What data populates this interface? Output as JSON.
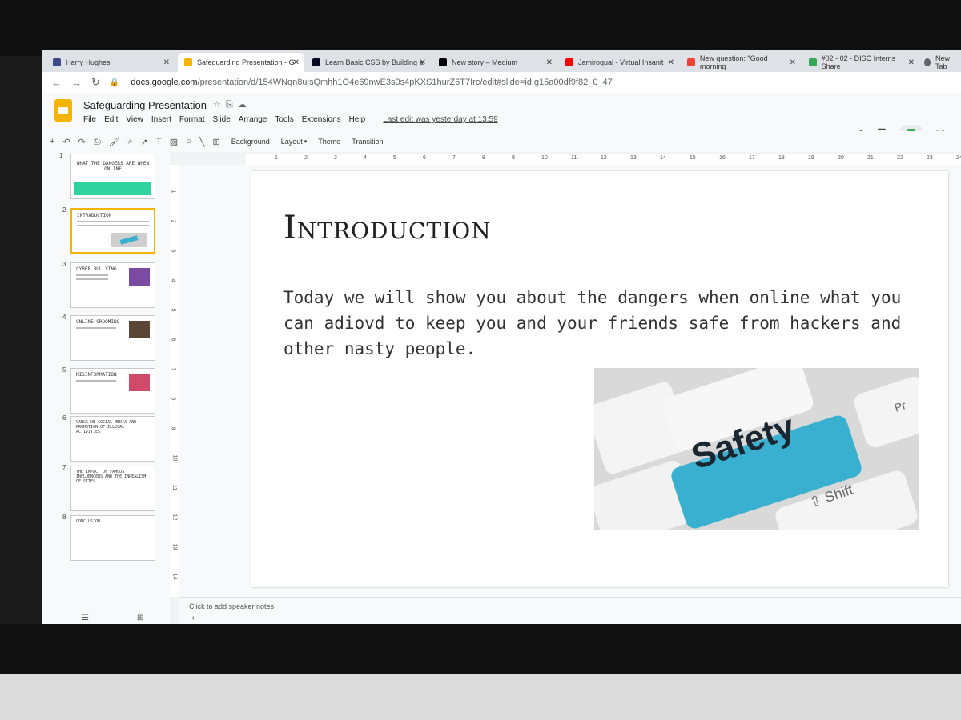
{
  "browser": {
    "tabs": [
      {
        "title": "Harry Hughes",
        "color": "#3c4a8a"
      },
      {
        "title": "Safeguarding Presentation - G",
        "color": "#f4b400",
        "active": true
      },
      {
        "title": "Learn Basic CSS by Building a",
        "color": "#0a0a23"
      },
      {
        "title": "New story – Medium",
        "color": "#000000"
      },
      {
        "title": "Jamiroquai - Virtual Insanit",
        "color": "#ff0000"
      },
      {
        "title": "New question: \"Good morning",
        "color": "#ea4335"
      },
      {
        "title": "#02 - 02 - DISC Interns Share",
        "color": "#34a853"
      },
      {
        "title": "New Tab",
        "color": "#5f6368"
      }
    ],
    "url_host": "docs.google.com",
    "url_path": "/presentation/d/154WNqn8ujsQmhh1O4e69nwE3s0s4pKXS1hurZ6T7Irc/edit#slide=id.g15a00df9f82_0_47"
  },
  "app": {
    "title": "Safeguarding Presentation",
    "menu": [
      "File",
      "Edit",
      "View",
      "Insert",
      "Format",
      "Slide",
      "Arrange",
      "Tools",
      "Extensions",
      "Help"
    ],
    "last_edit": "Last edit was yesterday at 13:59",
    "toolbar": {
      "background": "Background",
      "layout": "Layout",
      "theme": "Theme",
      "transition": "Transition"
    }
  },
  "ruler_h": [
    "1",
    "2",
    "3",
    "4",
    "5",
    "6",
    "7",
    "8",
    "9",
    "10",
    "11",
    "12",
    "13",
    "14",
    "15",
    "16",
    "17",
    "18",
    "19",
    "20",
    "21",
    "22",
    "23",
    "24"
  ],
  "ruler_v": [
    "1",
    "2",
    "3",
    "4",
    "5",
    "6",
    "7",
    "8",
    "9",
    "10",
    "11",
    "12",
    "13",
    "14"
  ],
  "filmstrip": [
    {
      "num": "1",
      "title": "What the dangers are when online"
    },
    {
      "num": "2",
      "title": "Introduction",
      "selected": true
    },
    {
      "num": "3",
      "title": "Cyber bullying"
    },
    {
      "num": "4",
      "title": "Online grooming"
    },
    {
      "num": "5",
      "title": "Misinformation"
    },
    {
      "num": "6",
      "title": "Gangs on social media and promotion of illegal activities"
    },
    {
      "num": "7",
      "title": "The impact of famous influencers and the inrealism of sites"
    },
    {
      "num": "8",
      "title": "Conclusion"
    }
  ],
  "slide": {
    "title": "Introduction",
    "body": "Today we will show you about the dangers when online what you can adiovd to keep you and your friends safe from hackers and other nasty people.",
    "image": {
      "key_label": "Safety",
      "shift_label": "⇧ Shift",
      "pr_label": "Pr",
      "accent_color": "#3ab0d0"
    }
  },
  "notes_placeholder": "Click to add speaker notes"
}
